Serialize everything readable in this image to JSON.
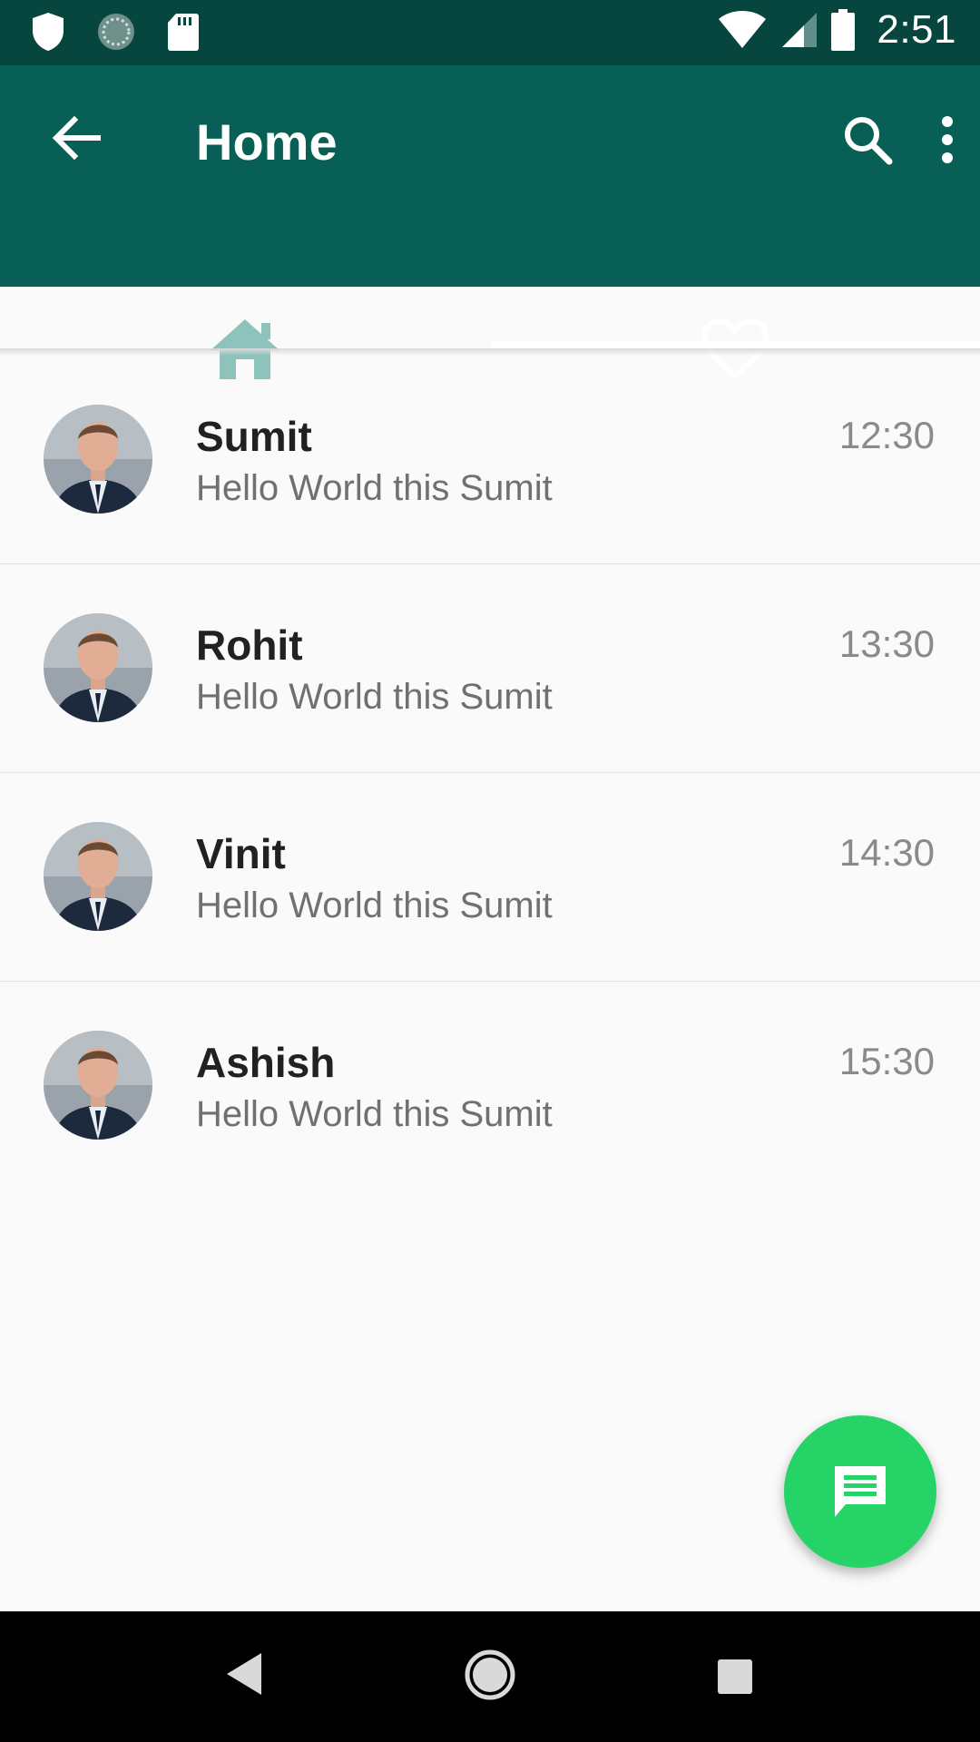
{
  "status_bar": {
    "time": "2:51",
    "left_icons": [
      "shield-icon",
      "sync-icon",
      "sd-card-icon"
    ],
    "right_icons": [
      "wifi-icon",
      "signal-icon",
      "battery-icon"
    ]
  },
  "app_bar": {
    "title": "Home",
    "actions": [
      "search-icon",
      "more-vert-icon"
    ],
    "tabs": [
      {
        "icon": "home-icon",
        "selected": false
      },
      {
        "icon": "heart-icon",
        "selected": true
      }
    ]
  },
  "chats": [
    {
      "name": "Sumit",
      "message": "Hello World this Sumit",
      "time": "12:30"
    },
    {
      "name": "Rohit",
      "message": "Hello World this Sumit",
      "time": "13:30"
    },
    {
      "name": "Vinit",
      "message": "Hello World this Sumit",
      "time": "14:30"
    },
    {
      "name": "Ashish",
      "message": "Hello World this Sumit",
      "time": "15:30"
    }
  ],
  "fab": {
    "icon": "message-icon"
  },
  "colors": {
    "status_bar": "#07463e",
    "app_bar": "#085f55",
    "fab": "#25d366",
    "background": "#fafafa"
  }
}
